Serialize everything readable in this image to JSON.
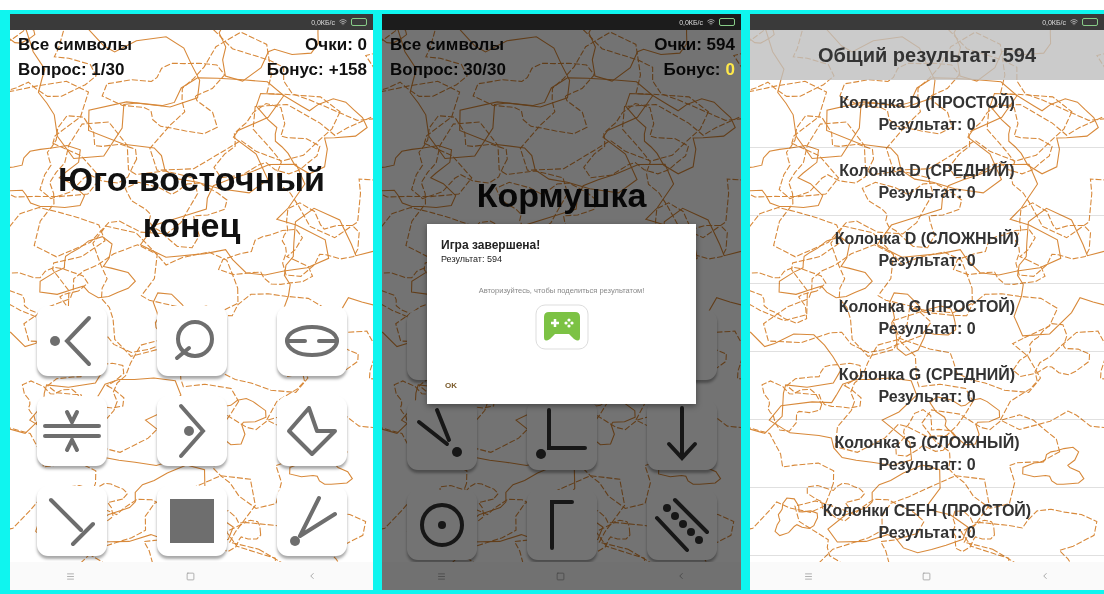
{
  "screens": [
    {
      "kind": "quiz",
      "status_speed": "0,0КБ/с",
      "category": "Все символы",
      "score": "Очки: 0",
      "question": "Вопрос: 1/30",
      "bonus_label": "Бонус:",
      "bonus_value": "+158",
      "bonus_highlighted": false,
      "prompt": "Юго-восточный конец",
      "dimmed": false
    },
    {
      "kind": "quiz",
      "status_speed": "0,0КБ/с",
      "category": "Все символы",
      "score": "Очки: 594",
      "question": "Вопрос: 30/30",
      "bonus_label": "Бонус:",
      "bonus_value": "0",
      "bonus_highlighted": true,
      "prompt": "Кормушка",
      "dimmed": true,
      "dialog": {
        "title": "Игра завершена!",
        "result": "Результат: 594",
        "message": "Авторизуйтесь, чтобы поделиться результатом!",
        "button": "OK"
      }
    },
    {
      "kind": "results",
      "status_speed": "0,0КБ/с",
      "total": "Общий результат: 594",
      "items": [
        {
          "title": "Колонка D (ПРОСТОЙ)",
          "result": "Результат: 0"
        },
        {
          "title": "Колонка D (СРЕДНИЙ)",
          "result": "Результат: 0"
        },
        {
          "title": "Колонка D (СЛОЖНЫЙ)",
          "result": "Результат: 0"
        },
        {
          "title": "Колонка G (ПРОСТОЙ)",
          "result": "Результат: 0"
        },
        {
          "title": "Колонка G (СРЕДНИЙ)",
          "result": "Результат: 0"
        },
        {
          "title": "Колонка G (СЛОЖНЫЙ)",
          "result": "Результат: 0"
        },
        {
          "title": "Колонки CEFH (ПРОСТОЙ)",
          "result": "Результат: 0"
        }
      ]
    }
  ]
}
